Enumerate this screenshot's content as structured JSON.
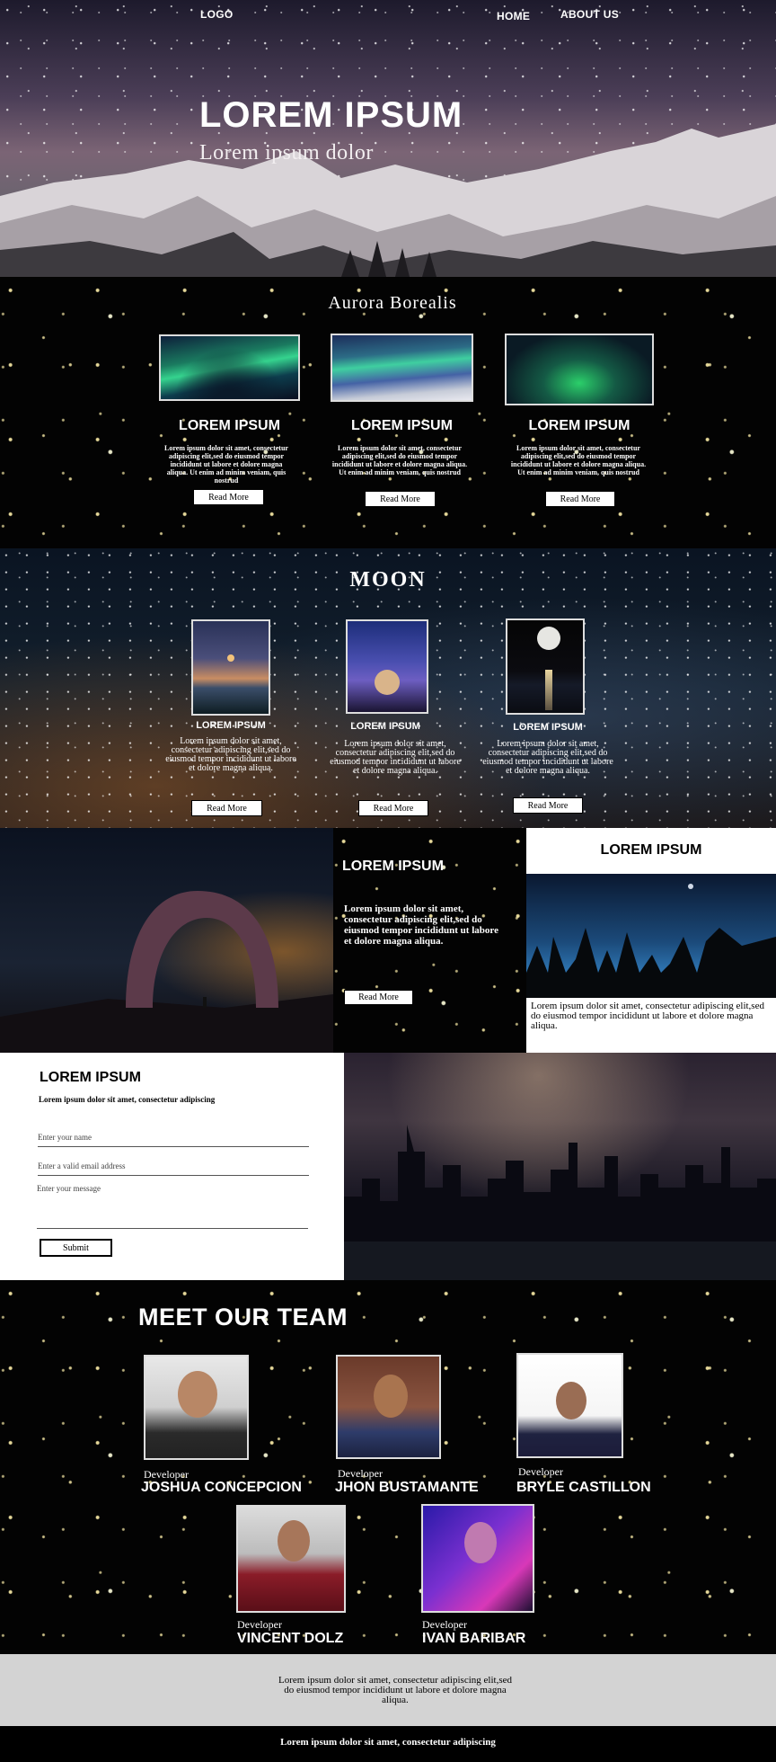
{
  "nav": {
    "logo": "LOGO",
    "home": "HOME",
    "about": "ABOUT US"
  },
  "hero": {
    "title": "LOREM IPSUM",
    "subtitle": "Lorem ipsum dolor"
  },
  "aurora": {
    "title": "Aurora Borealis",
    "cards": [
      {
        "heading": "LOREM IPSUM",
        "text": "Lorem ipsum dolor sit amet, consectetur adipiscing elit,sed do eiusmod tempor incididunt ut labore et dolore magna aliqua. Ut enim ad minim veniam, quis nostrud",
        "button": "Read More"
      },
      {
        "heading": "LOREM IPSUM",
        "text": "Lorem ipsum dolor sit amet, consectetur adipiscing elit,sed do eiusmod tempor incididunt ut labore et dolore magna aliqua. Ut enim ad minim veniam, quis nostrud",
        "button": "Read More"
      },
      {
        "heading": "LOREM IPSUM",
        "text": "Lorem ipsum dolor sit amet, consectetur adipiscing elit,sed do eiusmod tempor incididunt ut labore et dolore magna aliqua. Ut enim ad minim veniam, quis nostrud",
        "button": "Read More"
      }
    ]
  },
  "moon": {
    "title": "MOON",
    "cards": [
      {
        "heading": "LOREM IPSUM",
        "text": "Lorem ipsum dolor sit amet, consectetur adipiscing elit,sed do eiusmod tempor incididunt ut labore et dolore magna aliqua.",
        "button": "Read More"
      },
      {
        "heading": "LOREM IPSUM",
        "text": "Lorem ipsum dolor sit amet, consectetur adipiscing elit,sed do eiusmod tempor incididunt ut labore et dolore magna aliqua.",
        "button": "Read More"
      },
      {
        "heading": "LOREM IPSUM",
        "text": "Lorem ipsum dolor sit amet, consectetur adipiscing elit,sed do eiusmod tempor incididunt ut labore et dolore magna aliqua.",
        "button": "Read More"
      }
    ]
  },
  "feature": {
    "heading": "LOREM IPSUM",
    "text": "Lorem ipsum dolor sit amet, consectetur adipiscing elit,sed do eiusmod tempor incididunt ut labore et dolore magna aliqua.",
    "button": "Read More",
    "side_heading": "LOREM IPSUM",
    "side_text": "Lorem ipsum dolor sit amet, consectetur adipiscing elit,sed do eiusmod tempor incididunt ut labore et dolore magna aliqua."
  },
  "contact": {
    "heading": "LOREM IPSUM",
    "subtext": "Lorem ipsum dolor sit amet, consectetur adipiscing",
    "name_placeholder": "Enter your name",
    "email_placeholder": "Enter a valid email address",
    "message_placeholder": "Enter your message",
    "submit": "Submit"
  },
  "team": {
    "title": "MEET OUR TEAM",
    "members": [
      {
        "role": "Developer",
        "name": "JOSHUA CONCEPCION"
      },
      {
        "role": "Developer",
        "name": "JHON BUSTAMANTE"
      },
      {
        "role": "Developer",
        "name": "BRYLE CASTILLON"
      },
      {
        "role": "Developer",
        "name": "VINCENT DOLZ"
      },
      {
        "role": "Developer",
        "name": "IVAN BARIBAR"
      }
    ]
  },
  "footer": {
    "text": "Lorem ipsum dolor sit amet, consectetur adipiscing elit,sed do eiusmod tempor incididunt ut labore et dolore magna aliqua.",
    "bottom": "Lorem ipsum dolor sit amet, consectetur adipiscing"
  }
}
